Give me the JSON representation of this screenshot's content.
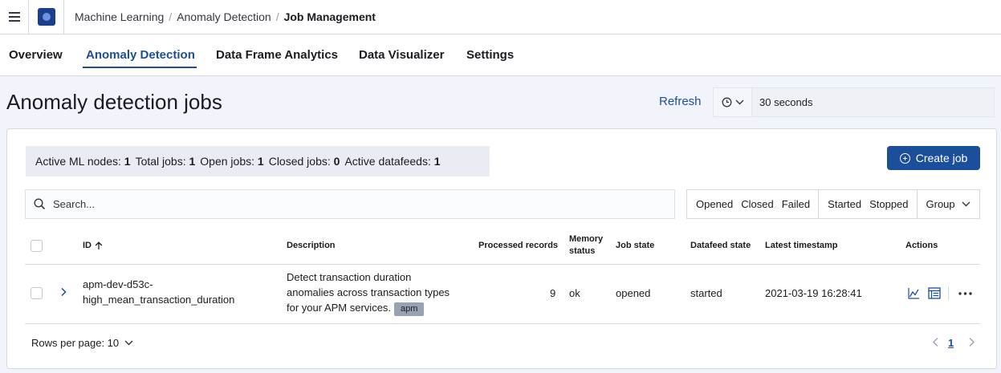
{
  "breadcrumbs": [
    "Machine Learning",
    "Anomaly Detection",
    "Job Management"
  ],
  "tabs": [
    {
      "label": "Overview",
      "active": false
    },
    {
      "label": "Anomaly Detection",
      "active": true
    },
    {
      "label": "Data Frame Analytics",
      "active": false
    },
    {
      "label": "Data Visualizer",
      "active": false
    },
    {
      "label": "Settings",
      "active": false
    }
  ],
  "page": {
    "title": "Anomaly detection jobs"
  },
  "refresh": {
    "label": "Refresh",
    "interval": "30 seconds"
  },
  "stats": {
    "active_nodes_label": "Active ML nodes:",
    "active_nodes": "1",
    "total_jobs_label": "Total jobs:",
    "total_jobs": "1",
    "open_jobs_label": "Open jobs:",
    "open_jobs": "1",
    "closed_jobs_label": "Closed jobs:",
    "closed_jobs": "0",
    "active_datafeeds_label": "Active datafeeds:",
    "active_datafeeds": "1"
  },
  "create_job": {
    "label": "Create job"
  },
  "search": {
    "placeholder": "Search..."
  },
  "filters": {
    "state": [
      "Opened",
      "Closed",
      "Failed"
    ],
    "datafeed": [
      "Started",
      "Stopped"
    ],
    "group": "Group"
  },
  "table": {
    "headers": {
      "id": "ID",
      "description": "Description",
      "processed_records": "Processed records",
      "memory_status_1": "Memory",
      "memory_status_2": "status",
      "job_state": "Job state",
      "datafeed_state": "Datafeed state",
      "latest_timestamp": "Latest timestamp",
      "actions": "Actions"
    },
    "rows": [
      {
        "id_line1": "apm-dev-d53c-",
        "id_line2": "high_mean_transaction_duration",
        "description_line1": "Detect transaction duration",
        "description_line2": "anomalies across transaction types",
        "description_line3": "for your APM services.",
        "badge": "apm",
        "processed_records": "9",
        "memory_status": "ok",
        "job_state": "opened",
        "datafeed_state": "started",
        "latest_timestamp": "2021-03-19 16:28:41"
      }
    ]
  },
  "pagination": {
    "rows_per_page": "Rows per page: 10",
    "current_page": "1"
  },
  "colors": {
    "accent": "#1b4f9c",
    "page_bg": "#f1f4fa",
    "badge_bg": "#98a2b3"
  }
}
